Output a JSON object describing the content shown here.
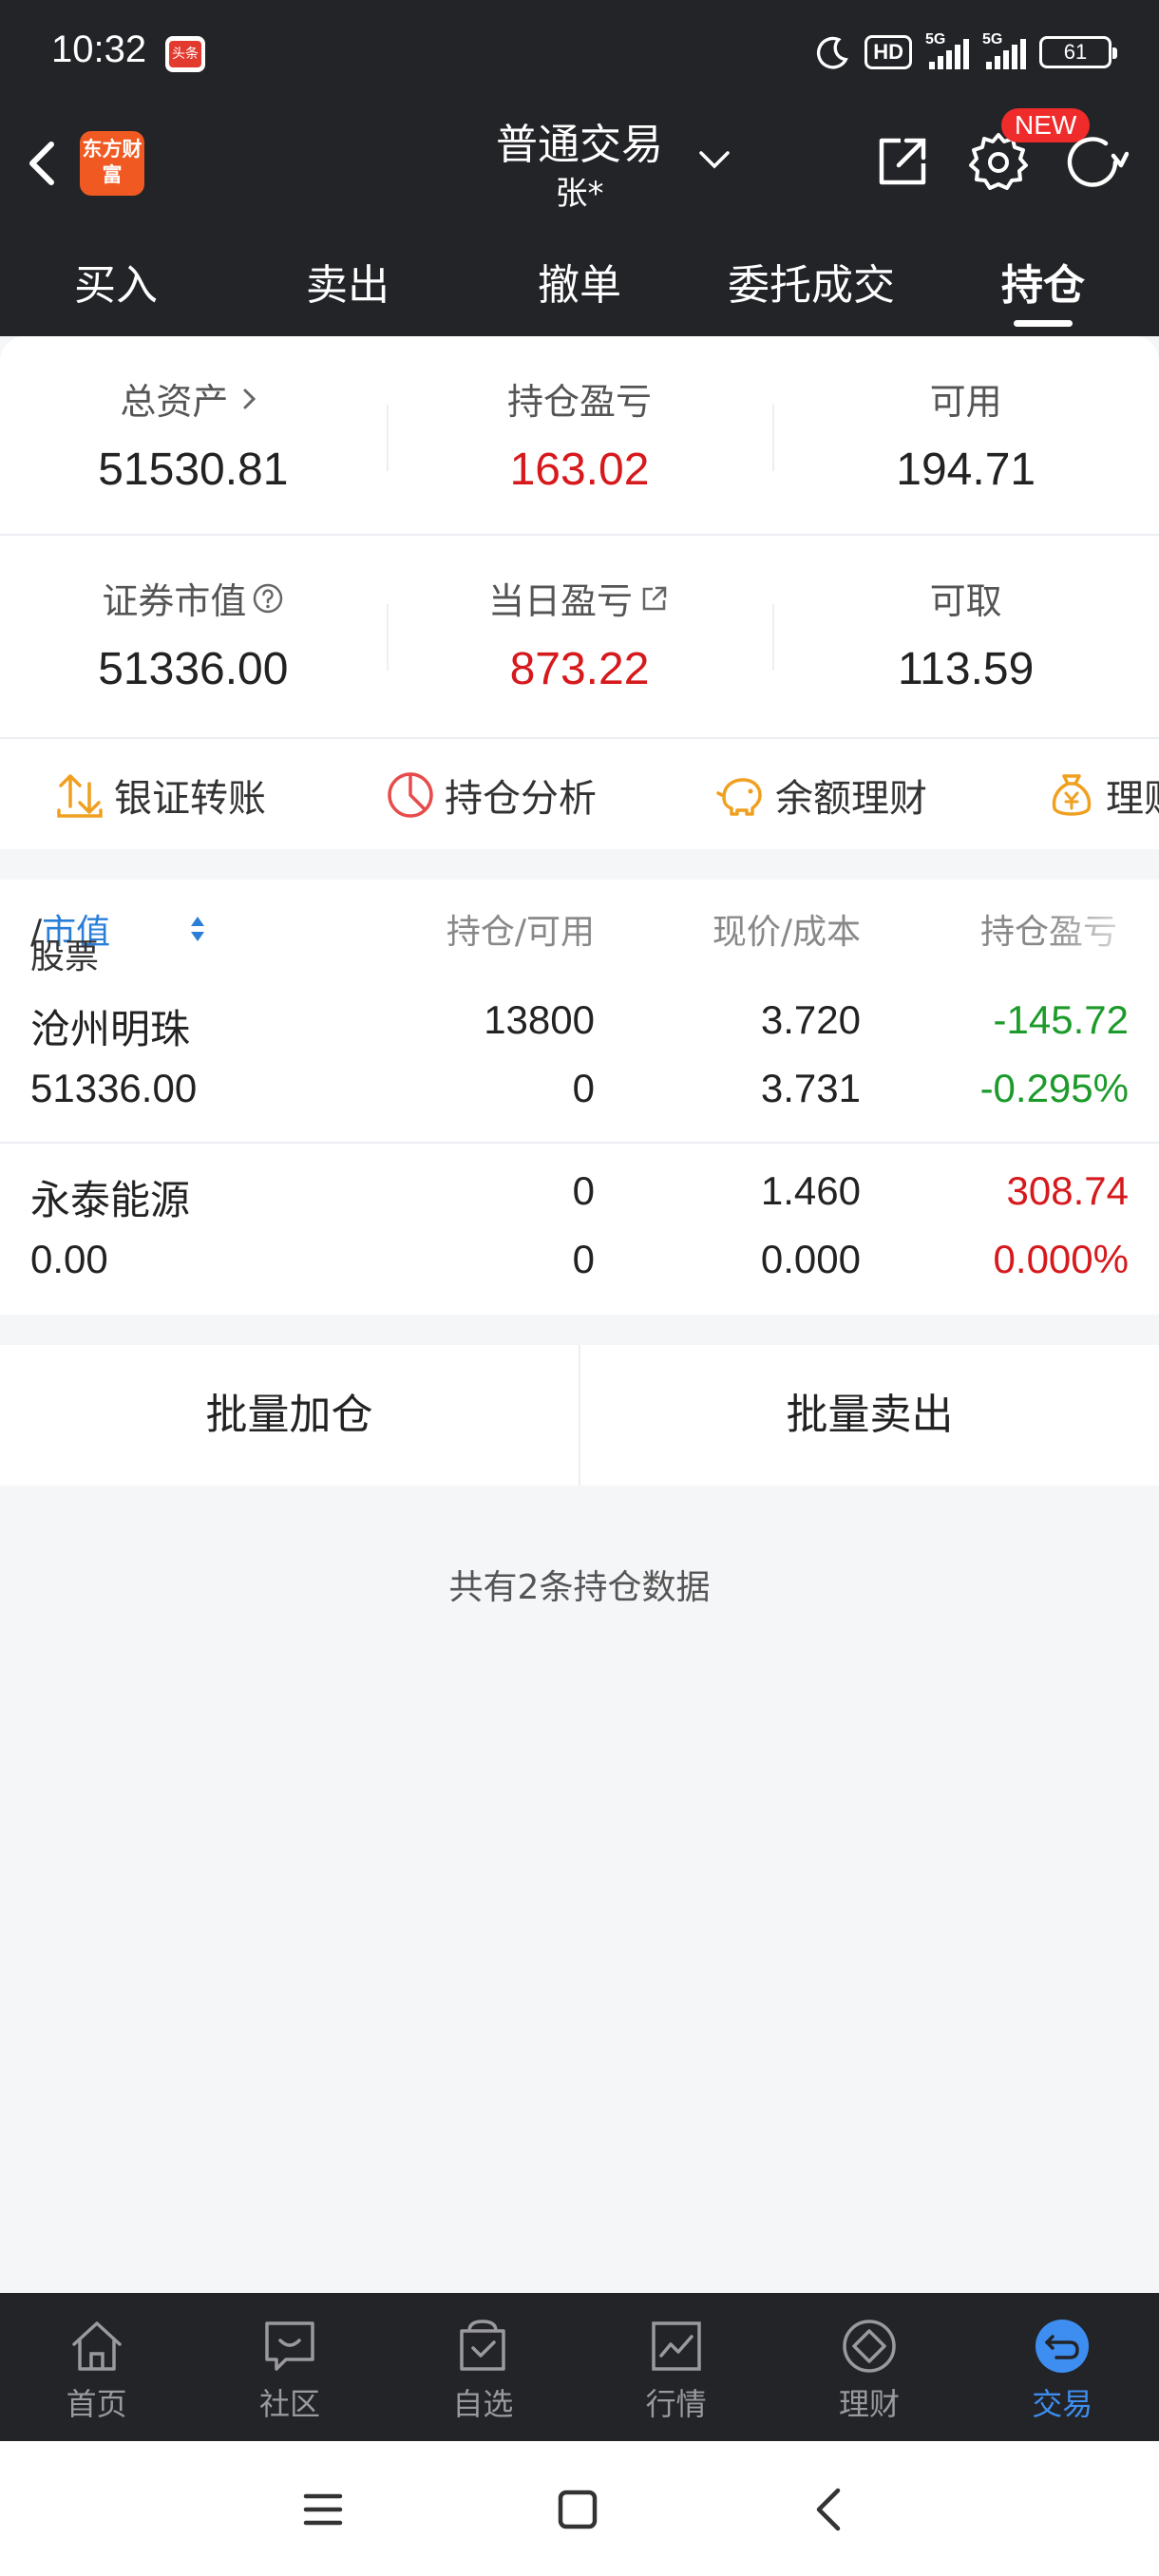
{
  "status_bar": {
    "time": "10:32",
    "app_badge": "头条",
    "hd": "HD",
    "network1": "5G",
    "network2": "5G",
    "battery": "61"
  },
  "header": {
    "logo_text": "东方财富",
    "title": "普通交易",
    "account": "张*",
    "new_badge": "NEW"
  },
  "tabs": [
    {
      "label": "买入"
    },
    {
      "label": "卖出"
    },
    {
      "label": "撤单"
    },
    {
      "label": "委托成交"
    },
    {
      "label": "持仓",
      "active": true
    }
  ],
  "summary": {
    "total_assets_label": "总资产",
    "total_assets": "51530.81",
    "position_pl_label": "持仓盈亏",
    "position_pl": "163.02",
    "available_label": "可用",
    "available": "194.71",
    "market_value_label": "证券市值",
    "market_value": "51336.00",
    "daily_pl_label": "当日盈亏",
    "daily_pl": "873.22",
    "withdrawable_label": "可取",
    "withdrawable": "113.59"
  },
  "quick_actions": [
    {
      "label": "银证转账",
      "icon": "transfer-icon"
    },
    {
      "label": "持仓分析",
      "icon": "pie-chart-icon"
    },
    {
      "label": "余额理财",
      "icon": "piggy-bank-icon"
    },
    {
      "label": "理财",
      "icon": "money-bag-icon"
    }
  ],
  "holdings": {
    "header": {
      "stock": "股票",
      "slash": "/",
      "market_value": "市值",
      "hold_avail": "持仓/可用",
      "price_cost": "现价/成本",
      "pl": "持仓盈亏"
    },
    "rows": [
      {
        "name": "沧州明珠",
        "market_value": "51336.00",
        "hold": "13800",
        "avail": "0",
        "price": "3.720",
        "cost": "3.731",
        "pl": "-145.72",
        "pl_pct": "-0.295%"
      },
      {
        "name": "永泰能源",
        "market_value": "0.00",
        "hold": "0",
        "avail": "0",
        "price": "1.460",
        "cost": "0.000",
        "pl": "308.74",
        "pl_pct": "0.000%"
      }
    ]
  },
  "batch": {
    "add_label": "批量加仓",
    "sell_label": "批量卖出"
  },
  "count_text": "共有2条持仓数据",
  "bottom_nav": [
    {
      "label": "首页",
      "icon": "home-icon"
    },
    {
      "label": "社区",
      "icon": "community-icon"
    },
    {
      "label": "自选",
      "icon": "watchlist-icon"
    },
    {
      "label": "行情",
      "icon": "market-icon"
    },
    {
      "label": "理财",
      "icon": "wealth-icon"
    },
    {
      "label": "交易",
      "icon": "trade-icon",
      "active": true
    }
  ],
  "colors": {
    "dark_bg": "#232428",
    "red": "#d6191c",
    "green": "#1c9a2a",
    "accent_blue": "#3d8ef0"
  }
}
